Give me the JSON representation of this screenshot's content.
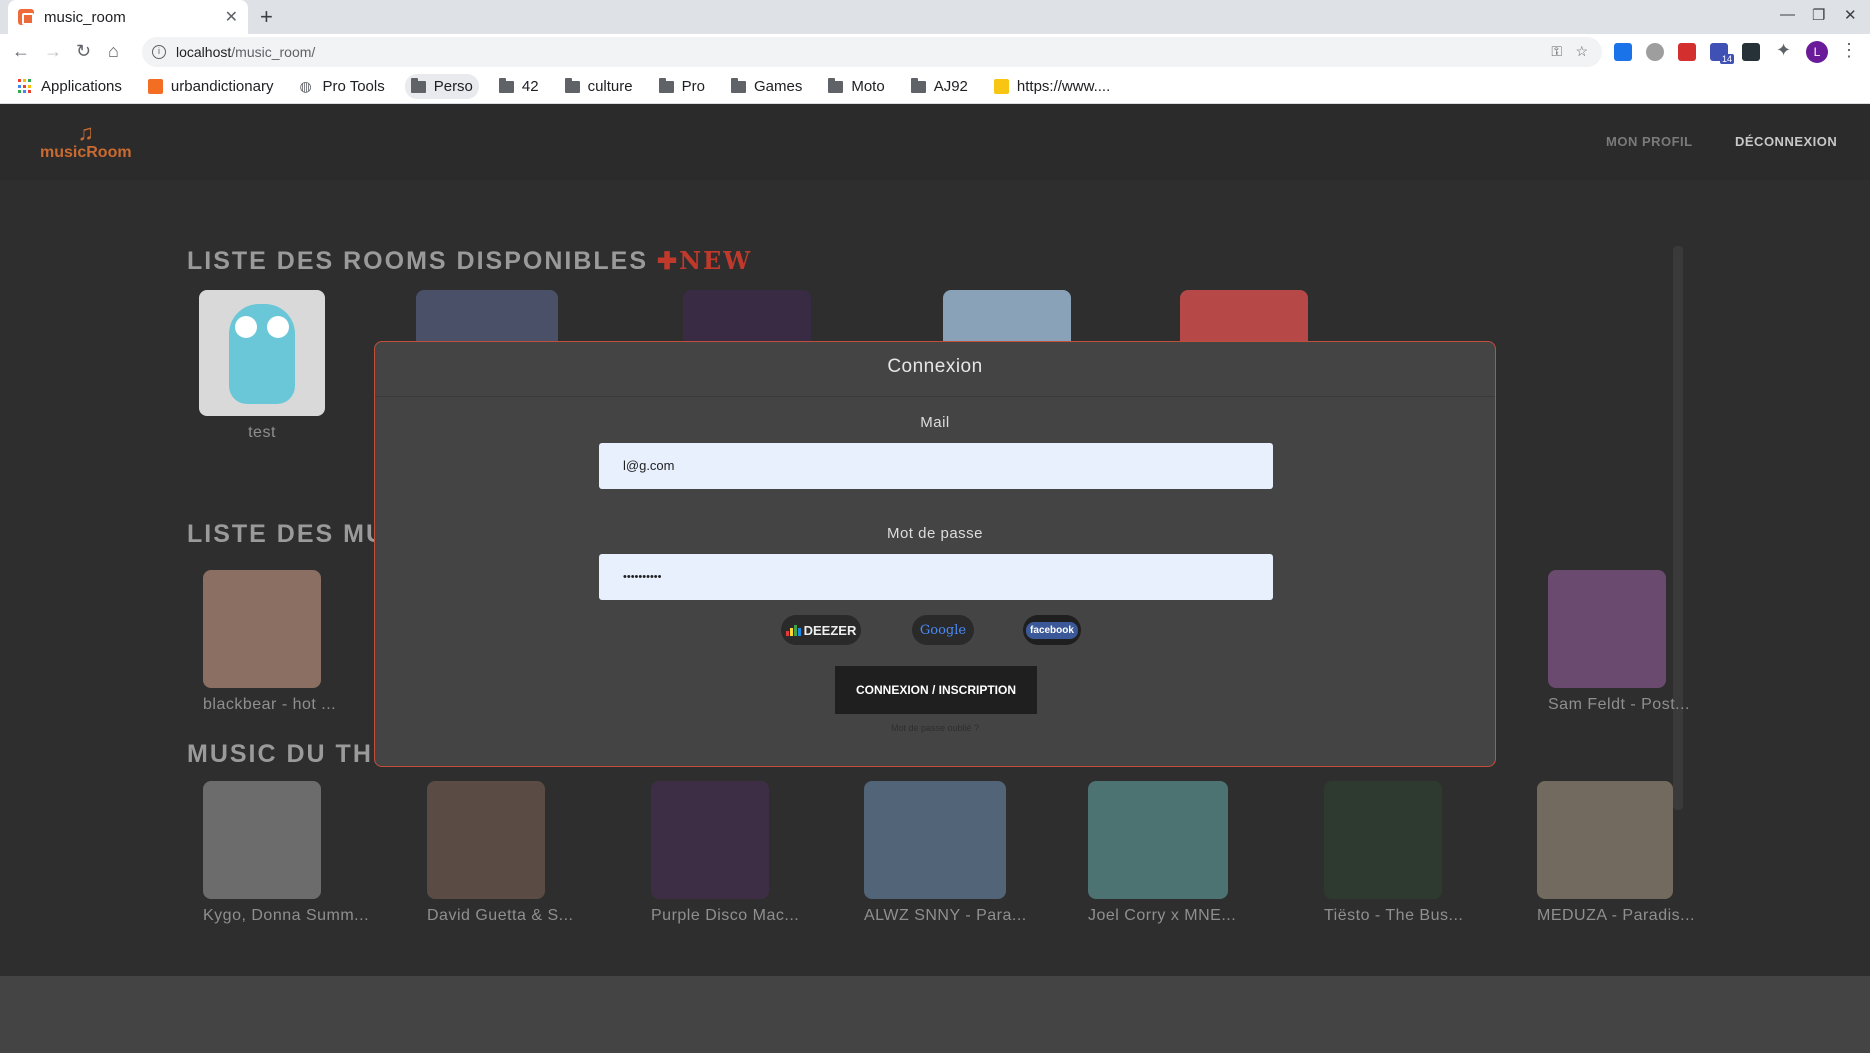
{
  "browser": {
    "tab_title": "music_room",
    "url_host": "localhost",
    "url_path": "/music_room/",
    "profile_initial": "L",
    "ext_badge": "14",
    "bookmarks": [
      {
        "label": "Applications",
        "icon": "apps-icon"
      },
      {
        "label": "urbandictionary",
        "icon": "ud-icon"
      },
      {
        "label": "Pro Tools",
        "icon": "globe-icon"
      },
      {
        "label": "Perso",
        "icon": "folder-icon",
        "active": true
      },
      {
        "label": "42",
        "icon": "folder-icon"
      },
      {
        "label": "culture",
        "icon": "folder-icon"
      },
      {
        "label": "Pro",
        "icon": "folder-icon"
      },
      {
        "label": "Games",
        "icon": "folder-icon"
      },
      {
        "label": "Moto",
        "icon": "folder-icon"
      },
      {
        "label": "AJ92",
        "icon": "folder-icon"
      },
      {
        "label": "https://www....",
        "icon": "pen-icon"
      }
    ]
  },
  "app": {
    "logo_text": "musicRoom",
    "nav": {
      "profile": "MON PROFIL",
      "logout": "DÉCONNEXION"
    },
    "rooms_title": "LISTE DES ROOMS DISPONIBLES",
    "new_label": "NEW",
    "musics_title": "LISTE DES MU",
    "theme_title": "MUSIC DU THE",
    "rooms": [
      {
        "label": "test",
        "color": "#d9d9d9"
      },
      {
        "label": "",
        "color": "#4a5068"
      },
      {
        "label": "",
        "color": "#3a2b44"
      },
      {
        "label": "",
        "color": "#8aa2b8"
      },
      {
        "label": "",
        "color": "#b64848"
      }
    ],
    "musics": [
      {
        "label": "blackbear - hot ...",
        "color": "#8a6f62"
      },
      {
        "label": "Sam Feldt - Post...",
        "color": "#6a4a6e"
      }
    ],
    "theme": [
      {
        "label": "Kygo, Donna Summ...",
        "color": "#6c6c6c"
      },
      {
        "label": "David Guetta & S...",
        "color": "#5a4c44"
      },
      {
        "label": "Purple Disco Mac...",
        "color": "#3d2e46"
      },
      {
        "label": "ALWZ SNNY - Para...",
        "color": "#516478"
      },
      {
        "label": "Joel Corry x MNE...",
        "color": "#4c7272"
      },
      {
        "label": "Tiësto - The Bus...",
        "color": "#2e3a30"
      },
      {
        "label": "MEDUZA - Paradis...",
        "color": "#726a5e"
      }
    ]
  },
  "modal": {
    "title": "Connexion",
    "mail_label": "Mail",
    "mail_value": "l@g.com",
    "password_label": "Mot de passe",
    "password_value": "••••••••••",
    "deezer_label": "DEEZER",
    "google_label": "Google",
    "facebook_label": "facebook",
    "submit_label": "CONNEXION / INSCRIPTION",
    "forgot_label": "Mot de passe oublié ?"
  }
}
